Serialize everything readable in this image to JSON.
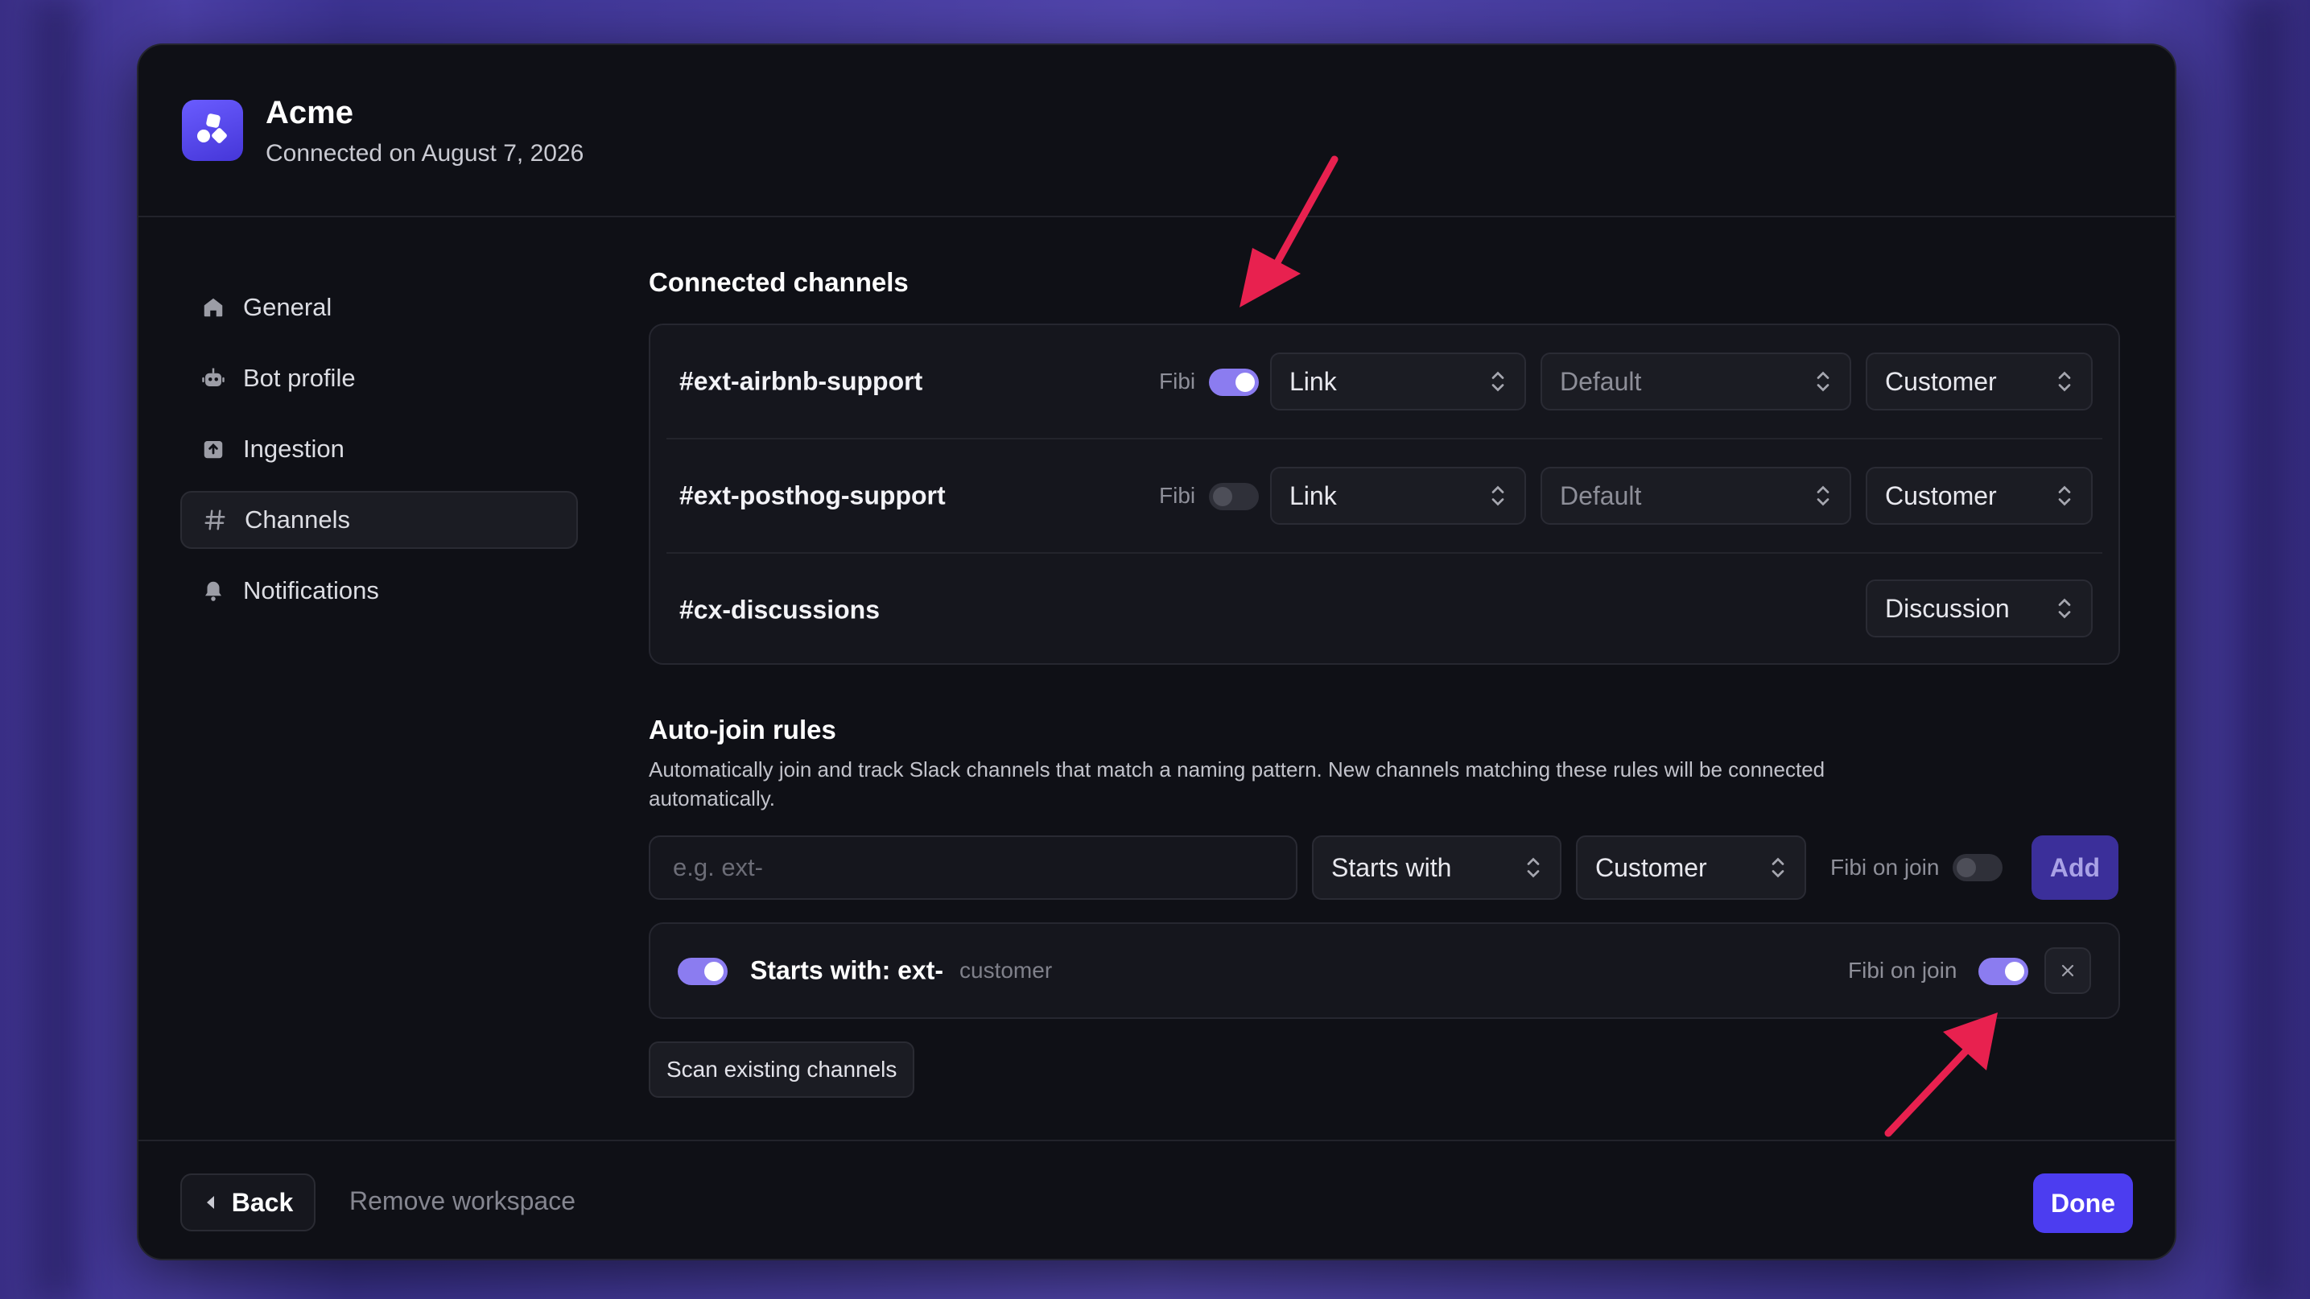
{
  "workspace": {
    "name": "Acme",
    "connected_text": "Connected on August 7, 2026",
    "logo_icon": "app-logo-icon"
  },
  "sidebar": {
    "items": [
      {
        "label": "General",
        "icon": "home-icon",
        "active": false
      },
      {
        "label": "Bot profile",
        "icon": "bot-icon",
        "active": false
      },
      {
        "label": "Ingestion",
        "icon": "inbox-upload-icon",
        "active": false
      },
      {
        "label": "Channels",
        "icon": "hash-icon",
        "active": true
      },
      {
        "label": "Notifications",
        "icon": "bell-icon",
        "active": false
      }
    ]
  },
  "connected_channels": {
    "title": "Connected channels",
    "fibi_label": "Fibi",
    "channels": [
      {
        "name": "#ext-airbnb-support",
        "fibi_enabled": true,
        "mode": "Link",
        "default": "Default",
        "type": "Customer"
      },
      {
        "name": "#ext-posthog-support",
        "fibi_enabled": false,
        "mode": "Link",
        "default": "Default",
        "type": "Customer"
      },
      {
        "name": "#cx-discussions",
        "type": "Discussion"
      }
    ]
  },
  "auto_join": {
    "title": "Auto-join rules",
    "description": "Automatically join and track Slack channels that match a naming pattern. New channels matching these rules will be connected automatically.",
    "pattern_placeholder": "e.g. ext-",
    "match_type": "Starts with",
    "channel_type": "Customer",
    "fibi_on_join_label": "Fibi on join",
    "fibi_on_join_enabled": false,
    "add_label": "Add",
    "rules": [
      {
        "enabled": true,
        "label": "Starts with: ext-",
        "tag": "customer",
        "fibi_on_join_label": "Fibi on join",
        "fibi_on_join": true
      }
    ],
    "scan_label": "Scan existing channels"
  },
  "footer": {
    "back_label": "Back",
    "remove_label": "Remove workspace",
    "done_label": "Done"
  },
  "colors": {
    "accent": "#4c3df0",
    "toggle_on": "#8b7cf0",
    "annotation_arrow": "#e8214f",
    "background": "#0f1016"
  }
}
